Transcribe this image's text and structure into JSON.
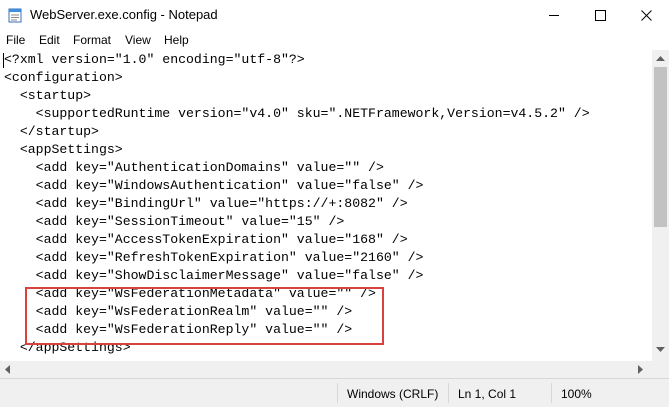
{
  "window": {
    "title": "WebServer.exe.config - Notepad",
    "controls": {
      "minimize": "minimize-icon",
      "maximize": "maximize-icon",
      "close": "close-icon"
    }
  },
  "menu": {
    "items": [
      "File",
      "Edit",
      "Format",
      "View",
      "Help"
    ]
  },
  "editor": {
    "lines": [
      "<?xml version=\"1.0\" encoding=\"utf-8\"?>",
      "<configuration>",
      "  <startup>",
      "    <supportedRuntime version=\"v4.0\" sku=\".NETFramework,Version=v4.5.2\" />",
      "  </startup>",
      "  <appSettings>",
      "    <add key=\"AuthenticationDomains\" value=\"\" />",
      "    <add key=\"WindowsAuthentication\" value=\"false\" />",
      "    <add key=\"BindingUrl\" value=\"https://+:8082\" />",
      "    <add key=\"SessionTimeout\" value=\"15\" />",
      "    <add key=\"AccessTokenExpiration\" value=\"168\" />",
      "    <add key=\"RefreshTokenExpiration\" value=\"2160\" />",
      "    <add key=\"ShowDisclaimerMessage\" value=\"false\" />",
      "    <add key=\"WsFederationMetadata\" value=\"\" />",
      "    <add key=\"WsFederationRealm\" value=\"\" />",
      "    <add key=\"WsFederationReply\" value=\"\" />",
      "  </appSettings>"
    ],
    "highlight_color": "#d9413f"
  },
  "statusbar": {
    "line_ending": "Windows (CRLF)",
    "position": "Ln 1, Col 1",
    "zoom": "100%"
  }
}
